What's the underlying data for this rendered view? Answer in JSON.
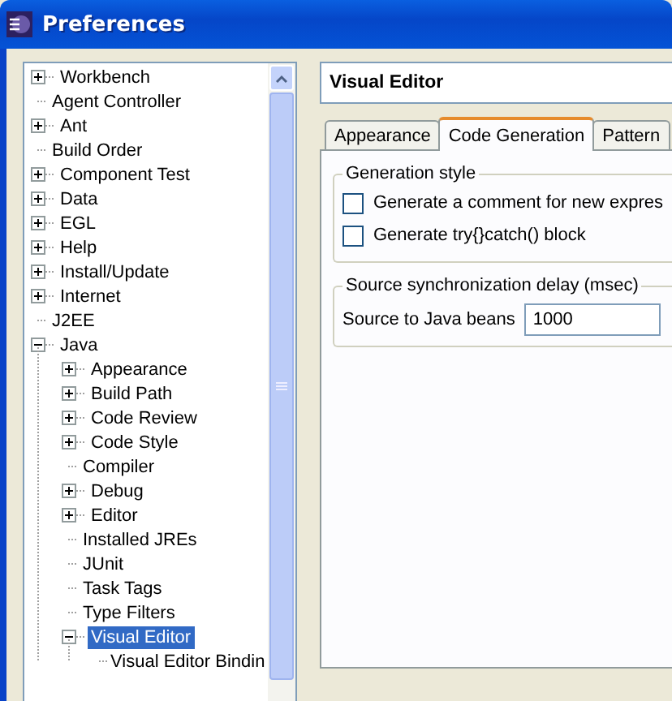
{
  "window": {
    "title": "Preferences"
  },
  "tree": [
    {
      "label": "Workbench",
      "expandable": true,
      "expanded": false,
      "selected": false
    },
    {
      "label": "Agent Controller",
      "expandable": false,
      "selected": false
    },
    {
      "label": "Ant",
      "expandable": true,
      "expanded": false,
      "selected": false
    },
    {
      "label": "Build Order",
      "expandable": false,
      "selected": false
    },
    {
      "label": "Component Test",
      "expandable": true,
      "expanded": false,
      "selected": false
    },
    {
      "label": "Data",
      "expandable": true,
      "expanded": false,
      "selected": false
    },
    {
      "label": "EGL",
      "expandable": true,
      "expanded": false,
      "selected": false
    },
    {
      "label": "Help",
      "expandable": true,
      "expanded": false,
      "selected": false
    },
    {
      "label": "Install/Update",
      "expandable": true,
      "expanded": false,
      "selected": false
    },
    {
      "label": "Internet",
      "expandable": true,
      "expanded": false,
      "selected": false
    },
    {
      "label": "J2EE",
      "expandable": false,
      "selected": false
    },
    {
      "label": "Java",
      "expandable": true,
      "expanded": true,
      "selected": false,
      "children": [
        {
          "label": "Appearance",
          "expandable": true,
          "expanded": false,
          "selected": false
        },
        {
          "label": "Build Path",
          "expandable": true,
          "expanded": false,
          "selected": false
        },
        {
          "label": "Code Review",
          "expandable": true,
          "expanded": false,
          "selected": false
        },
        {
          "label": "Code Style",
          "expandable": true,
          "expanded": false,
          "selected": false
        },
        {
          "label": "Compiler",
          "expandable": false,
          "selected": false
        },
        {
          "label": "Debug",
          "expandable": true,
          "expanded": false,
          "selected": false
        },
        {
          "label": "Editor",
          "expandable": true,
          "expanded": false,
          "selected": false
        },
        {
          "label": "Installed JREs",
          "expandable": false,
          "selected": false
        },
        {
          "label": "JUnit",
          "expandable": false,
          "selected": false
        },
        {
          "label": "Task Tags",
          "expandable": false,
          "selected": false
        },
        {
          "label": "Type Filters",
          "expandable": false,
          "selected": false
        },
        {
          "label": "Visual Editor",
          "expandable": true,
          "expanded": true,
          "selected": true,
          "children": [
            {
              "label": "Visual Editor Bindin",
              "expandable": false,
              "selected": false
            }
          ]
        }
      ]
    }
  ],
  "page_title": "Visual Editor",
  "tabs": [
    {
      "label": "Appearance",
      "selected": false
    },
    {
      "label": "Code Generation",
      "selected": true
    },
    {
      "label": "Pattern",
      "selected": false
    }
  ],
  "groups": [
    {
      "title": "Generation style",
      "kind": "checkboxes",
      "options": [
        {
          "label": "Generate a comment for new expres",
          "checked": false
        },
        {
          "label": "Generate try{}catch() block",
          "checked": false
        }
      ]
    },
    {
      "title": "Source synchronization delay (msec)",
      "kind": "field",
      "field_label": "Source to Java beans",
      "value": "1000"
    }
  ]
}
